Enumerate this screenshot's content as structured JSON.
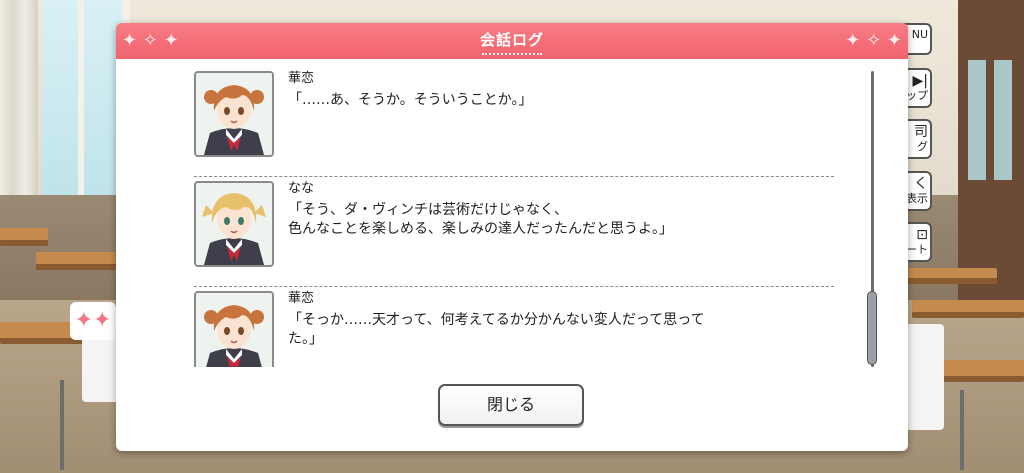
{
  "dialog": {
    "title": "会話ログ",
    "close_label": "閉じる"
  },
  "log": [
    {
      "speaker": "華恋",
      "text": "「……あ、そうか。そういうことか。」",
      "portrait_icon": "karen-portrait"
    },
    {
      "speaker": "なな",
      "text": "「そう、ダ・ヴィンチは芸術だけじゃなく、\n色んなことを楽しめる、楽しみの達人だったんだと思うよ。」",
      "portrait_icon": "nana-portrait"
    },
    {
      "speaker": "華恋",
      "text": "「そっか……天才って、何考えてるか分かんない変人だって思って\nた。」",
      "portrait_icon": "karen-portrait"
    }
  ],
  "side_menu": [
    {
      "symbol": "",
      "label": "NU"
    },
    {
      "symbol": "▶|",
      "label": "ップ"
    },
    {
      "symbol": "司",
      "label": "グ"
    },
    {
      "symbol": "く",
      "label": "表示"
    },
    {
      "symbol": "⊡",
      "label": "ート"
    }
  ],
  "colors": {
    "header": "#f1636d",
    "accent_sparkle": "#f27784"
  }
}
